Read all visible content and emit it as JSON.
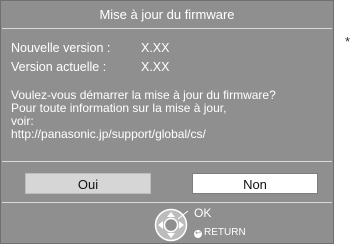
{
  "dialog": {
    "title": "Mise à jour du firmware",
    "new_version_label": "Nouvelle version :",
    "new_version_value": "X.XX",
    "current_version_label": "Version actuelle :",
    "current_version_value": "X.XX",
    "message_lines": [
      "Voulez-vous démarrer la mise à jour du firmware?",
      "Pour toute information sur la mise à jour,",
      "voir:",
      "http://panasonic.jp/support/global/cs/"
    ],
    "buttons": {
      "yes": "Oui",
      "no": "Non"
    },
    "hints": {
      "ok": "OK",
      "return": "RETURN"
    }
  },
  "side_note": "*",
  "colors": {
    "panel": "#8f8f8f",
    "selected_button": "#ffffff",
    "unselected_button": "#d6d6d6"
  },
  "icons": {
    "navigation": "dpad-icon",
    "return": "return-icon"
  }
}
